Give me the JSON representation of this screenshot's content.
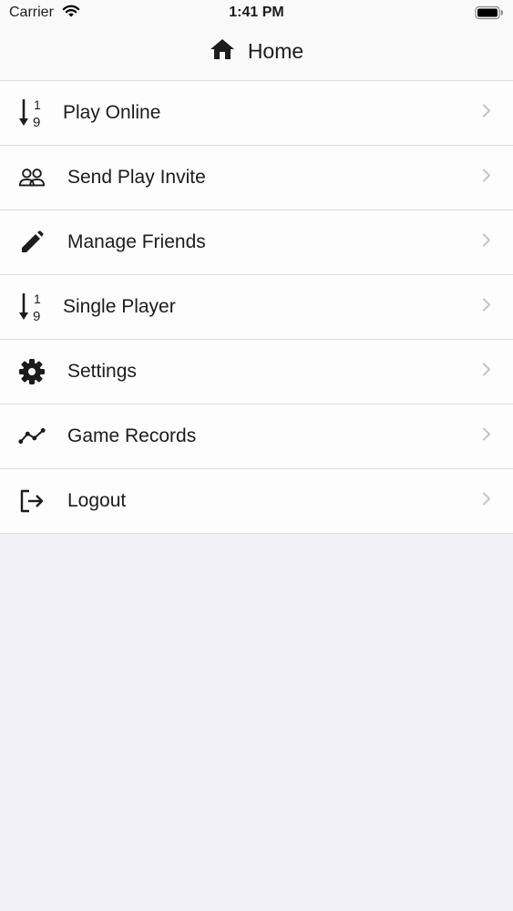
{
  "status": {
    "carrier": "Carrier",
    "time": "1:41 PM"
  },
  "nav": {
    "title": "Home",
    "icon": "home-icon"
  },
  "menu": [
    {
      "label": "Play Online",
      "icon": "sort-numeric-icon"
    },
    {
      "label": "Send Play Invite",
      "icon": "people-icon"
    },
    {
      "label": "Manage Friends",
      "icon": "pencil-icon"
    },
    {
      "label": "Single Player",
      "icon": "sort-numeric-icon"
    },
    {
      "label": "Settings",
      "icon": "gear-icon"
    },
    {
      "label": "Game Records",
      "icon": "line-chart-icon"
    },
    {
      "label": "Logout",
      "icon": "logout-icon"
    }
  ],
  "colors": {
    "background": "#f2f1f6",
    "list": "#fdfdfd",
    "text": "#1c1c1e",
    "chevron": "#c4c4c7"
  }
}
